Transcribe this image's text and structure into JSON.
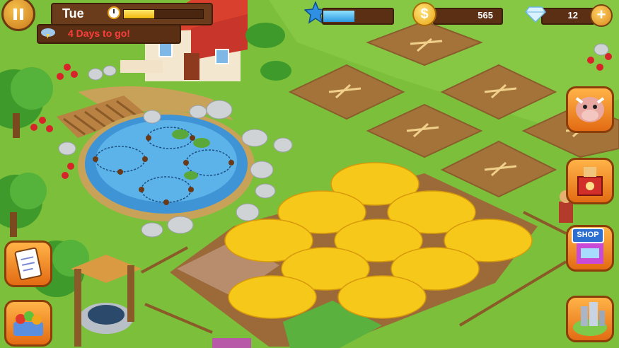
{
  "hud": {
    "day": "Tue",
    "day_progress": 0.38,
    "countdown": "4 Days to go!",
    "xp_progress": 0.45,
    "coins": "565",
    "diamonds": "12",
    "add_symbol": "+",
    "coin_symbol": "$"
  },
  "side_buttons": {
    "shop_label": "SHOP"
  },
  "colors": {
    "grass": "#7cbf3a",
    "soil": "#a3733a",
    "wheat": "#f5c81a",
    "water": "#4aa6df",
    "accent_orange": "#e36b13"
  },
  "icons": [
    "pause-icon",
    "clock-icon",
    "weather-icon",
    "star-icon",
    "coin-icon",
    "diamond-icon",
    "plus-icon",
    "cow-icon",
    "machine-icon",
    "shop-icon",
    "task-board-icon",
    "fruit-basket-icon",
    "city-icon"
  ]
}
